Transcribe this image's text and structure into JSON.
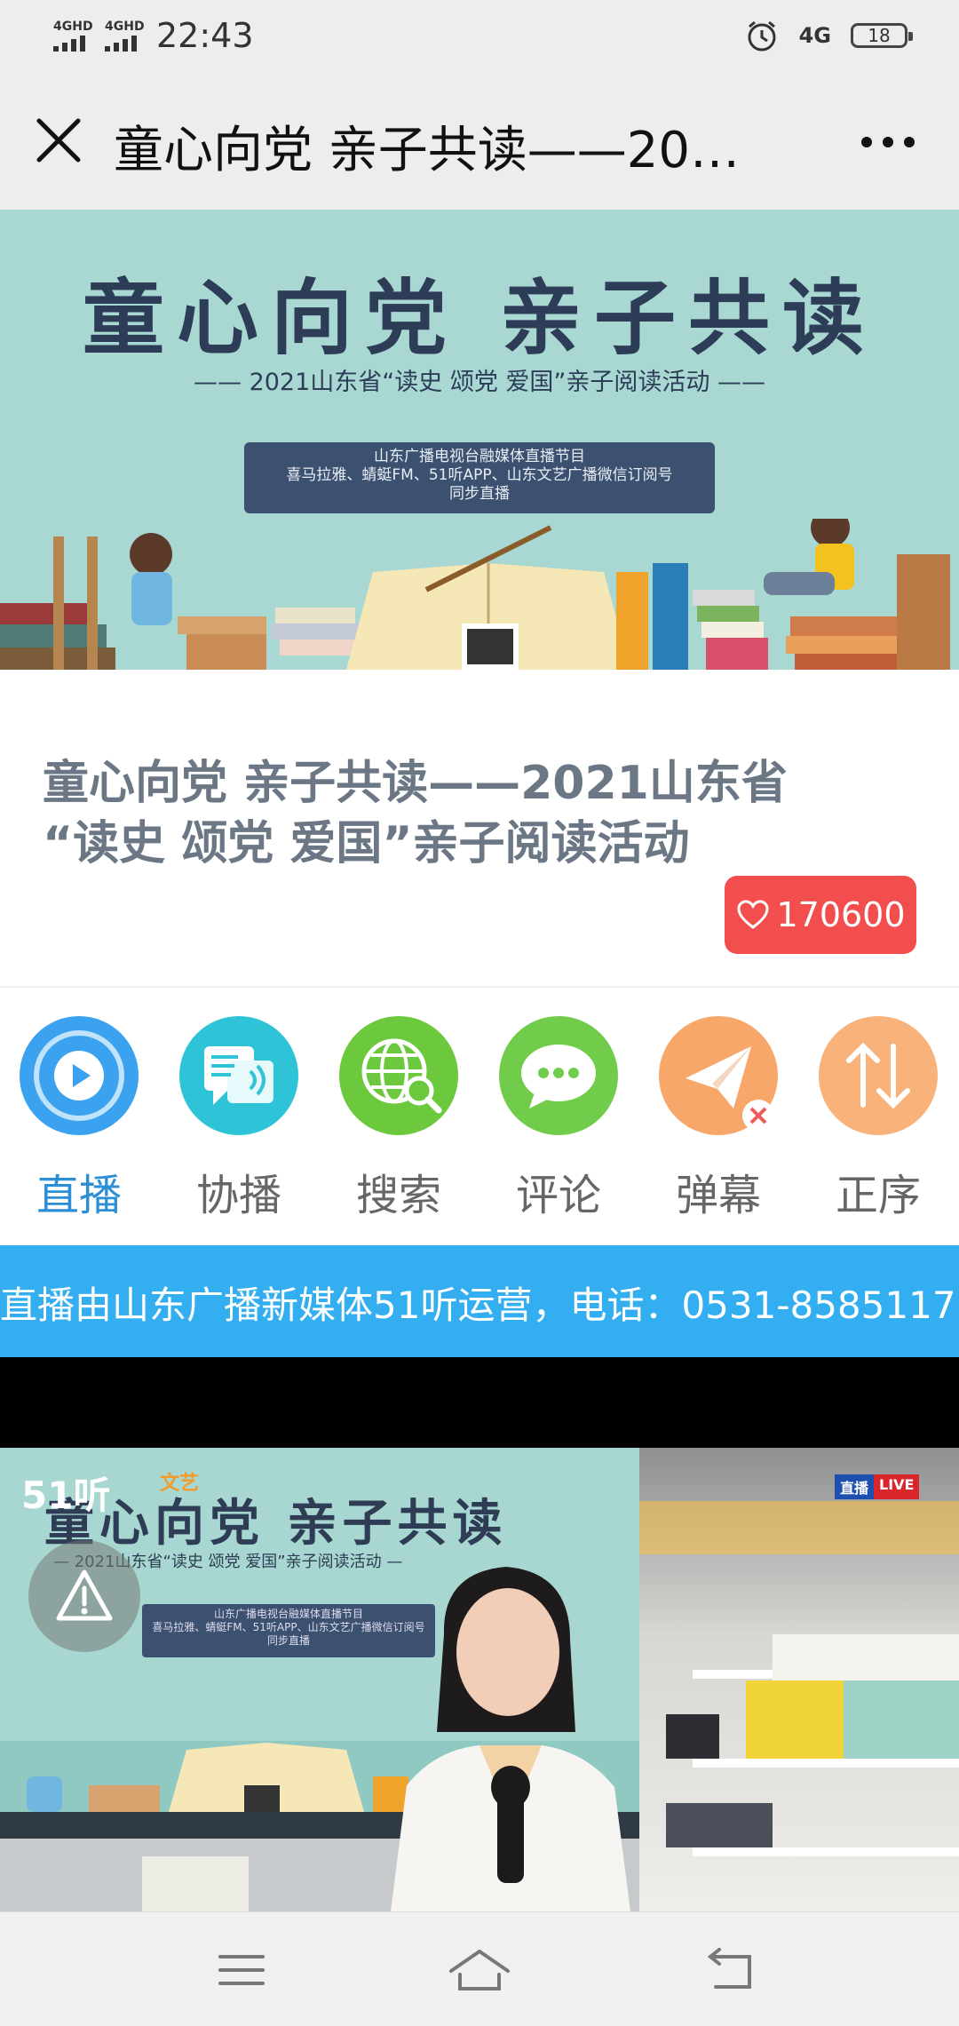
{
  "status_bar": {
    "signal1": "4GHD",
    "signal2": "4GHD",
    "time": "22:43",
    "network": "4G",
    "battery": "18"
  },
  "nav": {
    "title": "童心向党 亲子共读——20…"
  },
  "banner": {
    "title": "童心向党 亲子共读",
    "subtitle": "—— 2021山东省“读史 颂党 爱国”亲子阅读活动 ——",
    "box_lines": [
      "山东广播电视台融媒体直播节目",
      "喜马拉雅、蜻蜓FM、51听APP、山东文艺广播微信订阅号",
      "同步直播"
    ]
  },
  "main": {
    "title_line1": "童心向党 亲子共读——2021山东省",
    "title_line2": "“读史 颂党 爱国”亲子阅读活动",
    "likes": "170600"
  },
  "icons": [
    {
      "label": "直播",
      "icon": "play-icon",
      "color": "#3aa2ee",
      "active": true
    },
    {
      "label": "协播",
      "icon": "co-broadcast-icon",
      "color": "#2ec3d6"
    },
    {
      "label": "搜索",
      "icon": "search-globe-icon",
      "color": "#6cc93e"
    },
    {
      "label": "评论",
      "icon": "comment-icon",
      "color": "#70cc4a"
    },
    {
      "label": "弹幕",
      "icon": "paper-plane-icon",
      "color": "#f8a76a"
    },
    {
      "label": "正序",
      "icon": "sort-icon",
      "color": "#f8b27a"
    }
  ],
  "notice": {
    "text": "直播由山东广播新媒体51听运营，电话：0531-8585117"
  },
  "video": {
    "logo_51": "51听",
    "logo_wen": "文艺",
    "screen_title": "童心向党 亲子共读",
    "screen_sub": "— 2021山东省“读史 颂党 爱国”亲子阅读活动 —",
    "screen_box_lines": [
      "山东广播电视台融媒体直播节目",
      "喜马拉雅、蜻蜓FM、51听APP、山东文艺广播微信订阅号",
      "同步直播"
    ],
    "live_cn": "直播",
    "live_en": "LIVE"
  },
  "colors": {
    "accent_blue": "#33aef0",
    "like_red": "#f34e4e",
    "banner_teal": "#a9d8d2"
  }
}
